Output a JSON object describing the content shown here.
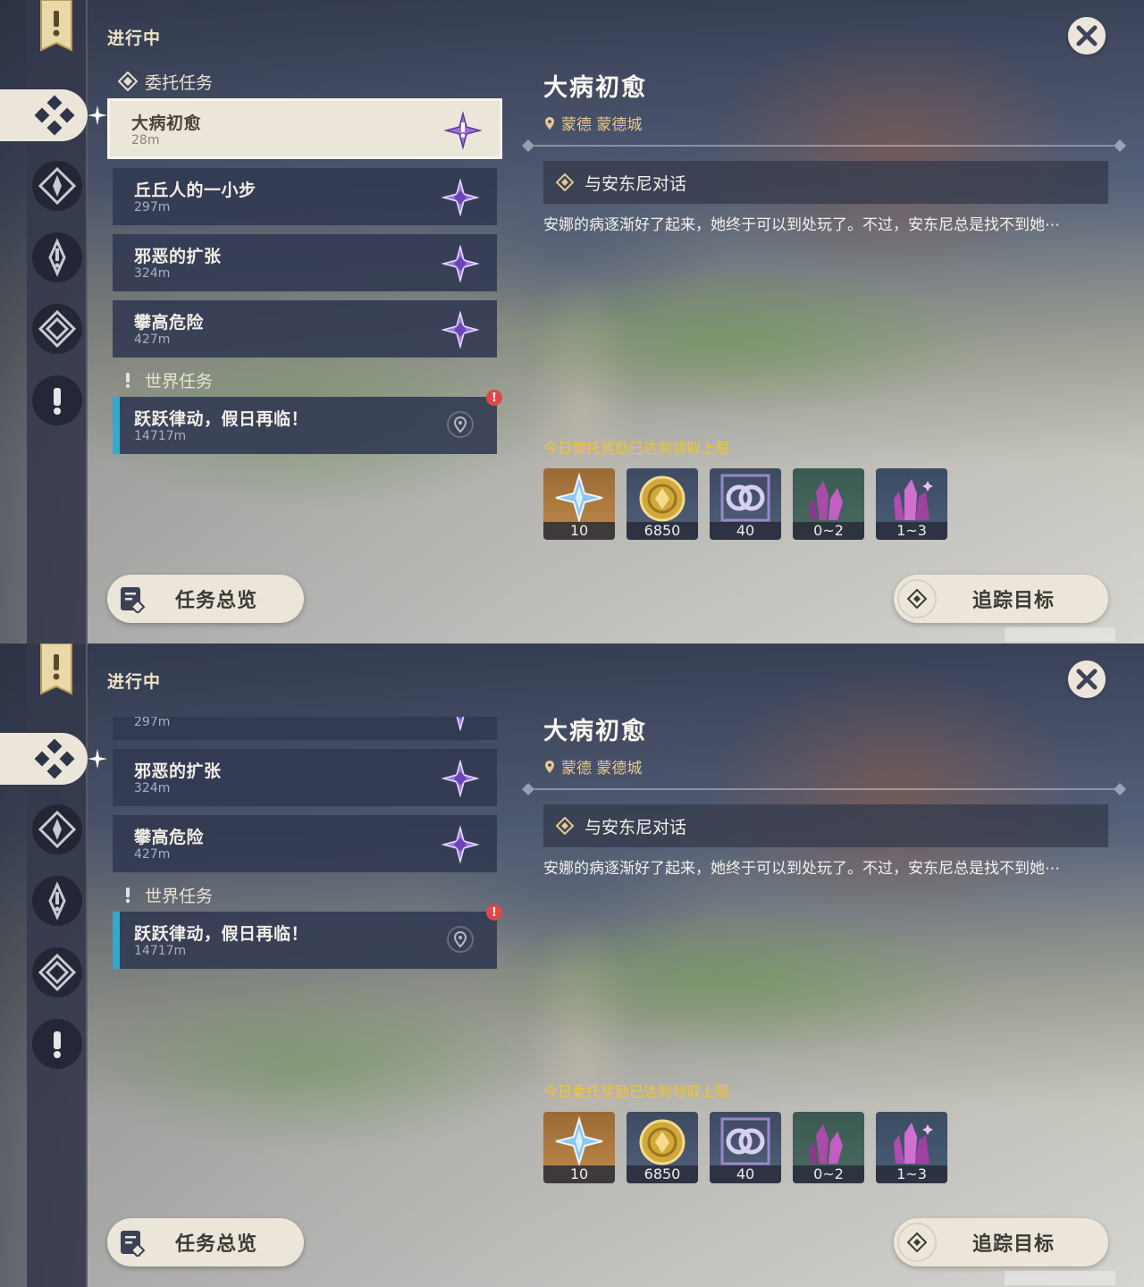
{
  "colors": {
    "accent_gold": "#f0c436",
    "panel_cream": "#ece6da",
    "card_dark": "#323a52",
    "world_marker": "#3aa6c8",
    "alert": "#e04848"
  },
  "header": {
    "title": "进行中"
  },
  "close_icon": "close-icon",
  "sidebar": {
    "icons": [
      "quest-banner-icon",
      "commission-icon",
      "archon-quest-icon",
      "world-quest-icon",
      "event-quest-icon",
      "exclamation-icon"
    ]
  },
  "sections": {
    "commission": "委托任务",
    "world": "世界任务"
  },
  "commissions": [
    {
      "name": "大病初愈",
      "distance": "28m"
    },
    {
      "name": "丘丘人的一小步",
      "distance": "297m"
    },
    {
      "name": "邪恶的扩张",
      "distance": "324m"
    },
    {
      "name": "攀高危险",
      "distance": "427m"
    }
  ],
  "world_quest": {
    "name": "跃跃律动，假日再临！",
    "distance": "14717m",
    "alert": "!"
  },
  "detail": {
    "title": "大病初愈",
    "location": "蒙德 蒙德城",
    "objective": "与安东尼对话",
    "description": "安娜的病逐渐好了起来，她终于可以到处玩了。不过，安东尼总是找不到她⋯",
    "reward_limit": "今日委托奖励已达到领取上限"
  },
  "rewards": [
    {
      "icon": "primogem-icon",
      "count": "10"
    },
    {
      "icon": "mora-icon",
      "count": "6850"
    },
    {
      "icon": "adventure-exp-icon",
      "count": "40"
    },
    {
      "icon": "ore-crystal-icon",
      "count": "0~2"
    },
    {
      "icon": "crystal-chunk-icon",
      "count": "1~3"
    }
  ],
  "buttons": {
    "overview": "任务总览",
    "track": "追踪目标"
  }
}
